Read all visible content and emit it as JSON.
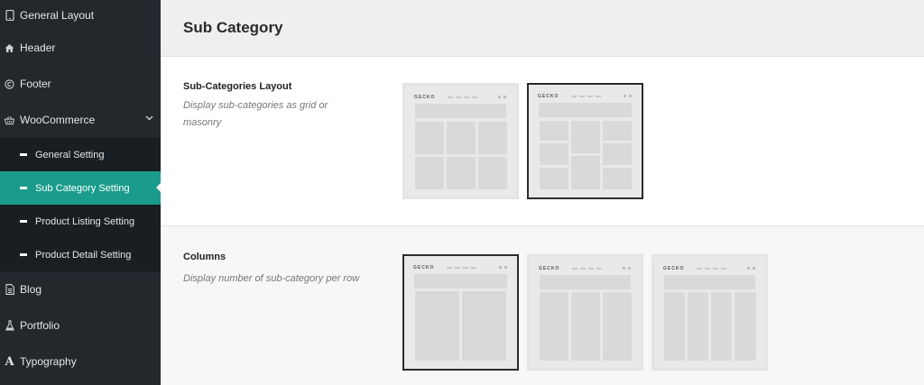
{
  "sidebar": {
    "items": [
      {
        "label": "General Layout",
        "icon": "tablet-icon"
      },
      {
        "label": "Header",
        "icon": "home-icon"
      },
      {
        "label": "Footer",
        "icon": "copyright-icon"
      },
      {
        "label": "WooCommerce",
        "icon": "basket-icon"
      }
    ],
    "sub_items": [
      {
        "label": "General Setting"
      },
      {
        "label": "Sub Category Setting"
      },
      {
        "label": "Product Listing Setting"
      },
      {
        "label": "Product Detail Setting"
      }
    ],
    "bottom_items": [
      {
        "label": "Blog",
        "icon": "file-icon"
      },
      {
        "label": "Portfolio",
        "icon": "flask-icon"
      },
      {
        "label": "Typography",
        "icon": "font-icon"
      }
    ]
  },
  "page": {
    "title": "Sub Category"
  },
  "sections": [
    {
      "title": "Sub-Categories Layout",
      "description": "Display sub-categories as grid or masonry",
      "selected": "masonry",
      "options": [
        "grid",
        "masonry"
      ]
    },
    {
      "title": "Columns",
      "description": "Display number of sub-category per row",
      "selected": "2",
      "options": [
        "2",
        "3",
        "4"
      ]
    }
  ],
  "thumb": {
    "logo": "GECKO"
  },
  "colors": {
    "sidebar_bg": "#23282d",
    "accent": "#1a9b8c"
  }
}
